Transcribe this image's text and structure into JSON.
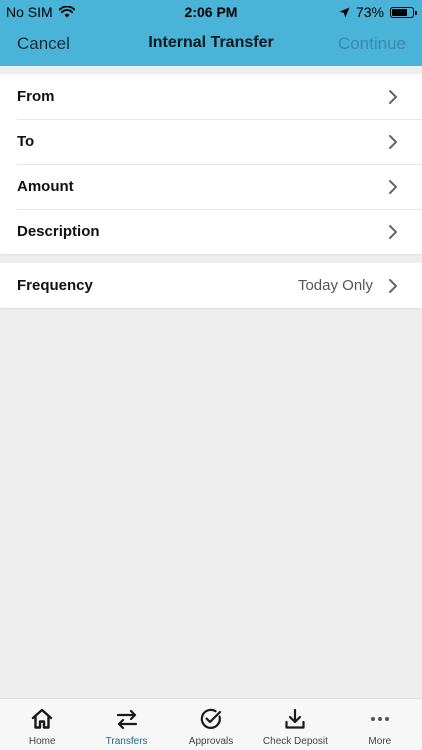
{
  "status_bar": {
    "carrier": "No SIM",
    "time": "2:06 PM",
    "battery": "73%",
    "battery_level": 0.73
  },
  "nav": {
    "cancel": "Cancel",
    "title": "Internal Transfer",
    "continue": "Continue"
  },
  "form": {
    "rows": [
      {
        "label": "From"
      },
      {
        "label": "To"
      },
      {
        "label": "Amount"
      },
      {
        "label": "Description"
      }
    ],
    "frequency": {
      "label": "Frequency",
      "value": "Today Only"
    }
  },
  "tabs": [
    {
      "label": "Home",
      "icon": "home-icon"
    },
    {
      "label": "Transfers",
      "icon": "transfer-arrows-icon",
      "active": true
    },
    {
      "label": "Approvals",
      "icon": "check-circle-icon"
    },
    {
      "label": "Check Deposit",
      "icon": "download-icon"
    },
    {
      "label": "More",
      "icon": "more-dots-icon"
    }
  ],
  "colors": {
    "header": "#49b3d8",
    "active_tab": "#1f6b8a",
    "background": "#efeeef"
  }
}
